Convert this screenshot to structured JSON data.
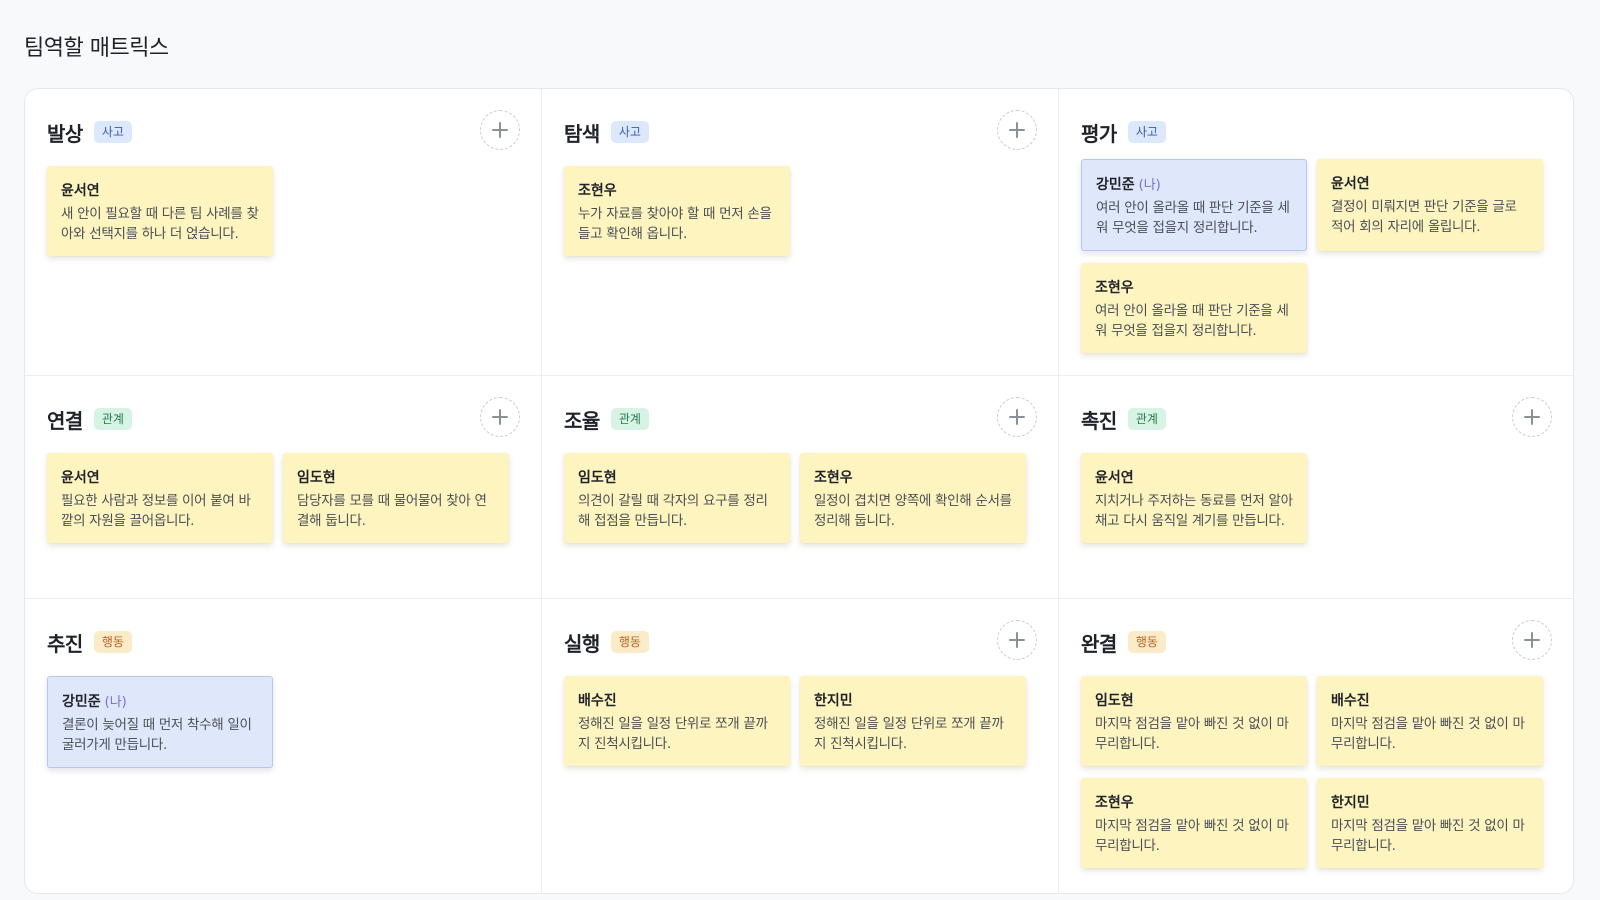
{
  "page_title": "팀역할 매트릭스",
  "cells": [
    {
      "name": "발상",
      "tag": "사고",
      "tag_type": "think",
      "add_icon": "plus-icon",
      "has_add": true,
      "cards": [
        {
          "author": "윤서연",
          "me": "",
          "text": "새 안이 필요할 때 다른 팀 사례를 찾아와 선택지를 하나 더 얹습니다."
        }
      ]
    },
    {
      "name": "탐색",
      "tag": "사고",
      "tag_type": "think",
      "add_icon": "plus-icon",
      "has_add": true,
      "cards": [
        {
          "author": "조현우",
          "me": "",
          "text": "누가 자료를 찾아야 할 때 먼저 손을 들고 확인해 옵니다."
        }
      ]
    },
    {
      "name": "평가",
      "tag": "사고",
      "tag_type": "think",
      "add_icon": "plus-icon",
      "has_add": false,
      "cards": [
        {
          "author": "강민준",
          "me": "(나)",
          "text": "여러 안이 올라올 때 판단 기준을 세워 무엇을 접을지 정리합니다."
        },
        {
          "author": "윤서연",
          "me": "",
          "text": "결정이 미뤄지면 판단 기준을 글로 적어 회의 자리에 올립니다."
        },
        {
          "author": "조현우",
          "me": "",
          "text": "여러 안이 올라올 때 판단 기준을 세워 무엇을 접을지 정리합니다."
        }
      ]
    },
    {
      "name": "연결",
      "tag": "관계",
      "tag_type": "rel",
      "add_icon": "plus-icon",
      "has_add": true,
      "cards": [
        {
          "author": "윤서연",
          "me": "",
          "text": "필요한 사람과 정보를 이어 붙여 바깥의 자원을 끌어옵니다."
        },
        {
          "author": "임도현",
          "me": "",
          "text": "담당자를 모를 때 물어물어 찾아 연결해 둡니다."
        }
      ]
    },
    {
      "name": "조율",
      "tag": "관계",
      "tag_type": "rel",
      "add_icon": "plus-icon",
      "has_add": true,
      "cards": [
        {
          "author": "임도현",
          "me": "",
          "text": "의견이 갈릴 때 각자의 요구를 정리해 접점을 만듭니다."
        },
        {
          "author": "조현우",
          "me": "",
          "text": "일정이 겹치면 양쪽에 확인해 순서를 정리해 둡니다."
        }
      ]
    },
    {
      "name": "촉진",
      "tag": "관계",
      "tag_type": "rel",
      "add_icon": "plus-icon",
      "has_add": true,
      "cards": [
        {
          "author": "윤서연",
          "me": "",
          "text": "지치거나 주저하는 동료를 먼저 알아채고 다시 움직일 계기를 만듭니다."
        }
      ]
    },
    {
      "name": "추진",
      "tag": "행동",
      "tag_type": "act",
      "add_icon": "plus-icon",
      "has_add": false,
      "cards": [
        {
          "author": "강민준",
          "me": "(나)",
          "text": "결론이 늦어질 때 먼저 착수해 일이 굴러가게 만듭니다."
        }
      ]
    },
    {
      "name": "실행",
      "tag": "행동",
      "tag_type": "act",
      "add_icon": "plus-icon",
      "has_add": true,
      "cards": [
        {
          "author": "배수진",
          "me": "",
          "text": "정해진 일을 일정 단위로 쪼개 끝까지 진척시킵니다."
        },
        {
          "author": "한지민",
          "me": "",
          "text": "정해진 일을 일정 단위로 쪼개 끝까지 진척시킵니다."
        }
      ]
    },
    {
      "name": "완결",
      "tag": "행동",
      "tag_type": "act",
      "add_icon": "plus-icon",
      "has_add": true,
      "cards": [
        {
          "author": "임도현",
          "me": "",
          "text": "마지막 점검을 맡아 빠진 것 없이 마무리합니다."
        },
        {
          "author": "배수진",
          "me": "",
          "text": "마지막 점검을 맡아 빠진 것 없이 마무리합니다."
        },
        {
          "author": "조현우",
          "me": "",
          "text": "마지막 점검을 맡아 빠진 것 없이 마무리합니다."
        },
        {
          "author": "한지민",
          "me": "",
          "text": "마지막 점검을 맡아 빠진 것 없이 마무리합니다."
        }
      ]
    }
  ]
}
